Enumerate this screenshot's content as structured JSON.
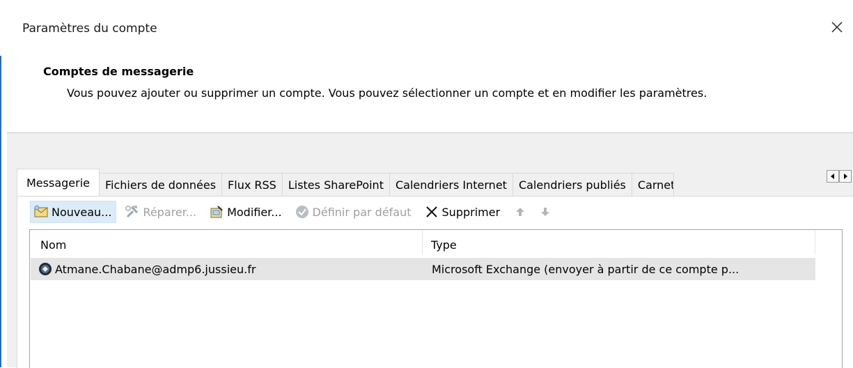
{
  "window": {
    "title": "Paramètres du compte",
    "close_icon": "close-icon"
  },
  "section": {
    "heading": "Comptes de messagerie",
    "description": "Vous pouvez ajouter ou supprimer un compte. Vous pouvez sélectionner un compte et en modifier les paramètres."
  },
  "tabs": [
    {
      "label": "Messagerie",
      "active": true
    },
    {
      "label": "Fichiers de données",
      "active": false
    },
    {
      "label": "Flux RSS",
      "active": false
    },
    {
      "label": "Listes SharePoint",
      "active": false
    },
    {
      "label": "Calendriers Internet",
      "active": false
    },
    {
      "label": "Calendriers publiés",
      "active": false
    },
    {
      "label": "Carnets d'adresses",
      "active": false
    }
  ],
  "tab_scroll": {
    "left_icon": "arrow-left-icon",
    "right_icon": "arrow-right-icon"
  },
  "toolbar": {
    "new_label": "Nouveau...",
    "repair_label": "Réparer...",
    "modify_label": "Modifier...",
    "default_label": "Définir par défaut",
    "delete_label": "Supprimer",
    "move_up_icon": "arrow-up-icon",
    "move_down_icon": "arrow-down-icon"
  },
  "list": {
    "columns": [
      "Nom",
      "Type"
    ],
    "rows": [
      {
        "name": "Atmane.Chabane@admp6.jussieu.fr",
        "type": "Microsoft Exchange (envoyer à partir de ce compte p...",
        "icon": "exchange-account-icon"
      }
    ]
  },
  "colors": {
    "accent_border": "#2b6cb0",
    "selected_row": "#e5e5e5",
    "hover_button": "#dcebf8"
  }
}
